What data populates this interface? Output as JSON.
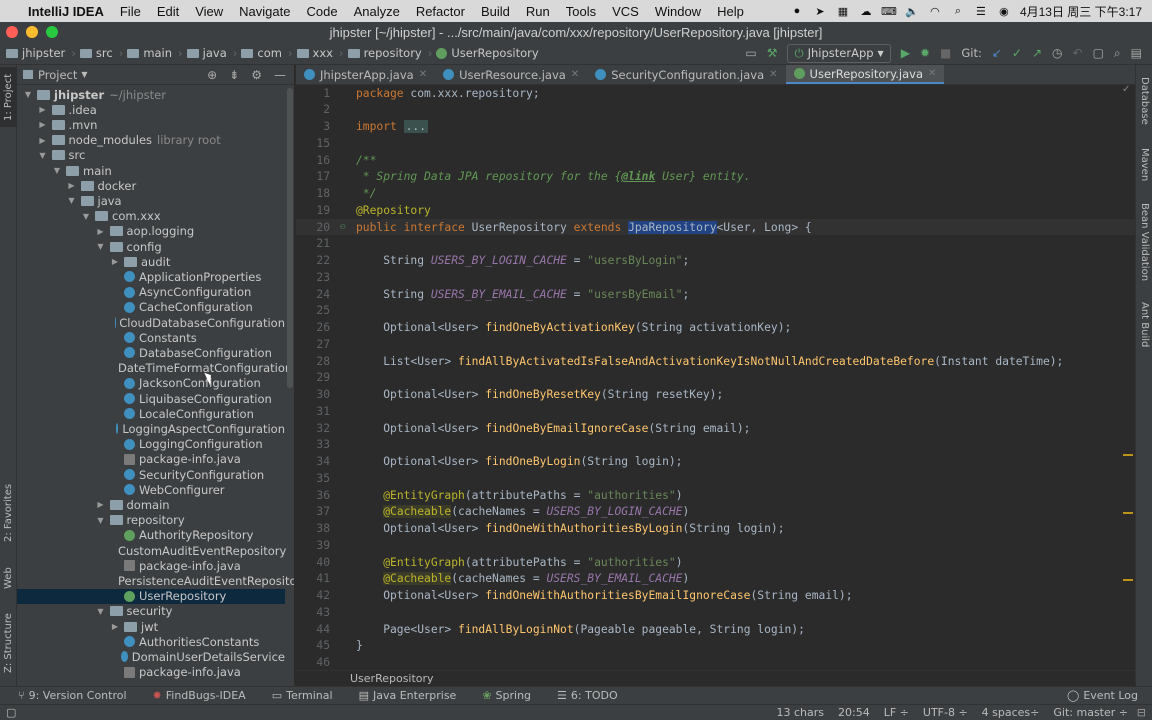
{
  "mac_menu": {
    "app": "IntelliJ IDEA",
    "items": [
      "File",
      "Edit",
      "View",
      "Navigate",
      "Code",
      "Analyze",
      "Refactor",
      "Build",
      "Run",
      "Tools",
      "VCS",
      "Window",
      "Help"
    ],
    "datetime": "4月13日 周三 下午3:17"
  },
  "window_title": "jhipster [~/jhipster] - .../src/main/java/com/xxx/repository/UserRepository.java [jhipster]",
  "breadcrumbs": [
    "jhipster",
    "src",
    "main",
    "java",
    "com",
    "xxx",
    "repository",
    "UserRepository"
  ],
  "run_config": "JhipsterApp",
  "git_label": "Git:",
  "project_panel": {
    "title": "Project",
    "tree": [
      {
        "label": "jhipster",
        "suffix": "~/jhipster",
        "level": 0,
        "icon": "folder",
        "arrow": "open",
        "bold": true
      },
      {
        "label": ".idea",
        "level": 1,
        "icon": "folder",
        "arrow": "closed"
      },
      {
        "label": ".mvn",
        "level": 1,
        "icon": "folder",
        "arrow": "closed"
      },
      {
        "label": "node_modules",
        "suffix": "library root",
        "level": 1,
        "icon": "folder",
        "arrow": "closed"
      },
      {
        "label": "src",
        "level": 1,
        "icon": "folder",
        "arrow": "open"
      },
      {
        "label": "main",
        "level": 2,
        "icon": "folder",
        "arrow": "open"
      },
      {
        "label": "docker",
        "level": 3,
        "icon": "folder",
        "arrow": "closed"
      },
      {
        "label": "java",
        "level": 3,
        "icon": "folder",
        "arrow": "open"
      },
      {
        "label": "com.xxx",
        "level": 4,
        "icon": "folder",
        "arrow": "open"
      },
      {
        "label": "aop.logging",
        "level": 5,
        "icon": "folder",
        "arrow": "closed"
      },
      {
        "label": "config",
        "level": 5,
        "icon": "folder",
        "arrow": "open"
      },
      {
        "label": "audit",
        "level": 6,
        "icon": "folder",
        "arrow": "closed"
      },
      {
        "label": "ApplicationProperties",
        "level": 6,
        "icon": "class"
      },
      {
        "label": "AsyncConfiguration",
        "level": 6,
        "icon": "class"
      },
      {
        "label": "CacheConfiguration",
        "level": 6,
        "icon": "class"
      },
      {
        "label": "CloudDatabaseConfiguration",
        "level": 6,
        "icon": "class"
      },
      {
        "label": "Constants",
        "level": 6,
        "icon": "class"
      },
      {
        "label": "DatabaseConfiguration",
        "level": 6,
        "icon": "class"
      },
      {
        "label": "DateTimeFormatConfiguration",
        "level": 6,
        "icon": "class"
      },
      {
        "label": "JacksonConfiguration",
        "level": 6,
        "icon": "class"
      },
      {
        "label": "LiquibaseConfiguration",
        "level": 6,
        "icon": "class"
      },
      {
        "label": "LocaleConfiguration",
        "level": 6,
        "icon": "class"
      },
      {
        "label": "LoggingAspectConfiguration",
        "level": 6,
        "icon": "class"
      },
      {
        "label": "LoggingConfiguration",
        "level": 6,
        "icon": "class"
      },
      {
        "label": "package-info.java",
        "level": 6,
        "icon": "file"
      },
      {
        "label": "SecurityConfiguration",
        "level": 6,
        "icon": "class"
      },
      {
        "label": "WebConfigurer",
        "level": 6,
        "icon": "class"
      },
      {
        "label": "domain",
        "level": 5,
        "icon": "folder",
        "arrow": "closed"
      },
      {
        "label": "repository",
        "level": 5,
        "icon": "folder",
        "arrow": "open"
      },
      {
        "label": "AuthorityRepository",
        "level": 6,
        "icon": "interface"
      },
      {
        "label": "CustomAuditEventRepository",
        "level": 6,
        "icon": "class"
      },
      {
        "label": "package-info.java",
        "level": 6,
        "icon": "file"
      },
      {
        "label": "PersistenceAuditEventRepository",
        "level": 6,
        "icon": "interface"
      },
      {
        "label": "UserRepository",
        "level": 6,
        "icon": "interface",
        "selected": true
      },
      {
        "label": "security",
        "level": 5,
        "icon": "folder",
        "arrow": "open"
      },
      {
        "label": "jwt",
        "level": 6,
        "icon": "folder",
        "arrow": "closed"
      },
      {
        "label": "AuthoritiesConstants",
        "level": 6,
        "icon": "class"
      },
      {
        "label": "DomainUserDetailsService",
        "level": 6,
        "icon": "class"
      },
      {
        "label": "package-info.java",
        "level": 6,
        "icon": "file"
      }
    ]
  },
  "editor_tabs": [
    {
      "label": "JhipsterApp.java",
      "active": false
    },
    {
      "label": "UserResource.java",
      "active": false
    },
    {
      "label": "SecurityConfiguration.java",
      "active": false
    },
    {
      "label": "UserRepository.java",
      "active": true
    }
  ],
  "code_lines": [
    {
      "n": "1",
      "html": "<span class='kw'>package</span> com.xxx.repository;"
    },
    {
      "n": "2",
      "html": ""
    },
    {
      "n": "3",
      "html": "<span class='kw'>import</span> <span class='fold-ell'>...</span>"
    },
    {
      "n": "15",
      "html": ""
    },
    {
      "n": "16",
      "html": "<span class='cm'>/**</span>"
    },
    {
      "n": "17",
      "html": "<span class='cm'> * Spring Data JPA repository for the {</span><span class='cmtag'>@link</span><span class='cm'> User} entity.</span>"
    },
    {
      "n": "18",
      "html": "<span class='cm'> */</span>"
    },
    {
      "n": "19",
      "html": "<span class='ann'>@Repository</span>"
    },
    {
      "n": "20",
      "html": "<span class='kw'>public interface</span> UserRepository <span class='kw'>extends</span> <span class='hl'>JpaRepository</span>&lt;User, Long&gt; {",
      "current": true
    },
    {
      "n": "21",
      "html": ""
    },
    {
      "n": "22",
      "html": "    String <span class='cst'>USERS_BY_LOGIN_CACHE</span> = <span class='str'>\"usersByLogin\"</span>;"
    },
    {
      "n": "23",
      "html": ""
    },
    {
      "n": "24",
      "html": "    String <span class='cst'>USERS_BY_EMAIL_CACHE</span> = <span class='str'>\"usersByEmail\"</span>;"
    },
    {
      "n": "25",
      "html": ""
    },
    {
      "n": "26",
      "html": "    Optional&lt;User&gt; <span class='fn'>findOneByActivationKey</span>(String activationKey);"
    },
    {
      "n": "27",
      "html": ""
    },
    {
      "n": "28",
      "html": "    List&lt;User&gt; <span class='fn'>findAllByActivatedIsFalseAndActivationKeyIsNotNullAndCreatedDateBefore</span>(Instant dateTime);"
    },
    {
      "n": "29",
      "html": ""
    },
    {
      "n": "30",
      "html": "    Optional&lt;User&gt; <span class='fn'>findOneByResetKey</span>(String resetKey);"
    },
    {
      "n": "31",
      "html": ""
    },
    {
      "n": "32",
      "html": "    Optional&lt;User&gt; <span class='fn'>findOneByEmailIgnoreCase</span>(String email);"
    },
    {
      "n": "33",
      "html": ""
    },
    {
      "n": "34",
      "html": "    Optional&lt;User&gt; <span class='fn'>findOneByLogin</span>(String login);"
    },
    {
      "n": "35",
      "html": ""
    },
    {
      "n": "36",
      "html": "    <span class='ann'>@EntityGraph</span>(attributePaths = <span class='str'>\"authorities\"</span>)"
    },
    {
      "n": "37",
      "html": "    <span class='annbg'>@Cacheable</span>(cacheNames = <span class='cst'>USERS_BY_LOGIN_CACHE</span>)"
    },
    {
      "n": "38",
      "html": "    Optional&lt;User&gt; <span class='fn'>findOneWithAuthoritiesByLogin</span>(String login);"
    },
    {
      "n": "39",
      "html": ""
    },
    {
      "n": "40",
      "html": "    <span class='ann'>@EntityGraph</span>(attributePaths = <span class='str'>\"authorities\"</span>)"
    },
    {
      "n": "41",
      "html": "    <span class='annbg'>@Cacheable</span>(cacheNames = <span class='cst'>USERS_BY_EMAIL_CACHE</span>)"
    },
    {
      "n": "42",
      "html": "    Optional&lt;User&gt; <span class='fn'>findOneWithAuthoritiesByEmailIgnoreCase</span>(String email);"
    },
    {
      "n": "43",
      "html": ""
    },
    {
      "n": "44",
      "html": "    Page&lt;User&gt; <span class='fn'>findAllByLoginNot</span>(Pageable pageable, String login);"
    },
    {
      "n": "45",
      "html": "}"
    },
    {
      "n": "46",
      "html": ""
    }
  ],
  "editor_breadcrumb": "UserRepository",
  "left_tabs": [
    "1: Project",
    "2: Favorites",
    "Web",
    "Z: Structure"
  ],
  "right_tabs": [
    "Database",
    "Maven",
    "Bean Validation",
    "Ant Build"
  ],
  "bottom_tools": [
    {
      "label": "9: Version Control",
      "icon": "vcs-icon"
    },
    {
      "label": "FindBugs-IDEA",
      "icon": "bug-icon"
    },
    {
      "label": "Terminal",
      "icon": "terminal-icon"
    },
    {
      "label": "Java Enterprise",
      "icon": "java-enterprise-icon"
    },
    {
      "label": "Spring",
      "icon": "spring-icon"
    },
    {
      "label": "6: TODO",
      "icon": "todo-icon"
    }
  ],
  "event_log": "Event Log",
  "status": {
    "chars": "13 chars",
    "position": "20:54",
    "line_sep": "LF ÷",
    "encoding": "UTF-8 ÷",
    "indent": "4 spaces÷",
    "git": "Git: master ÷"
  },
  "colors": {
    "accent": "#4a88c7",
    "selection": "#2f65ca",
    "background": "#2b2b2b",
    "panel": "#3c3f41"
  }
}
